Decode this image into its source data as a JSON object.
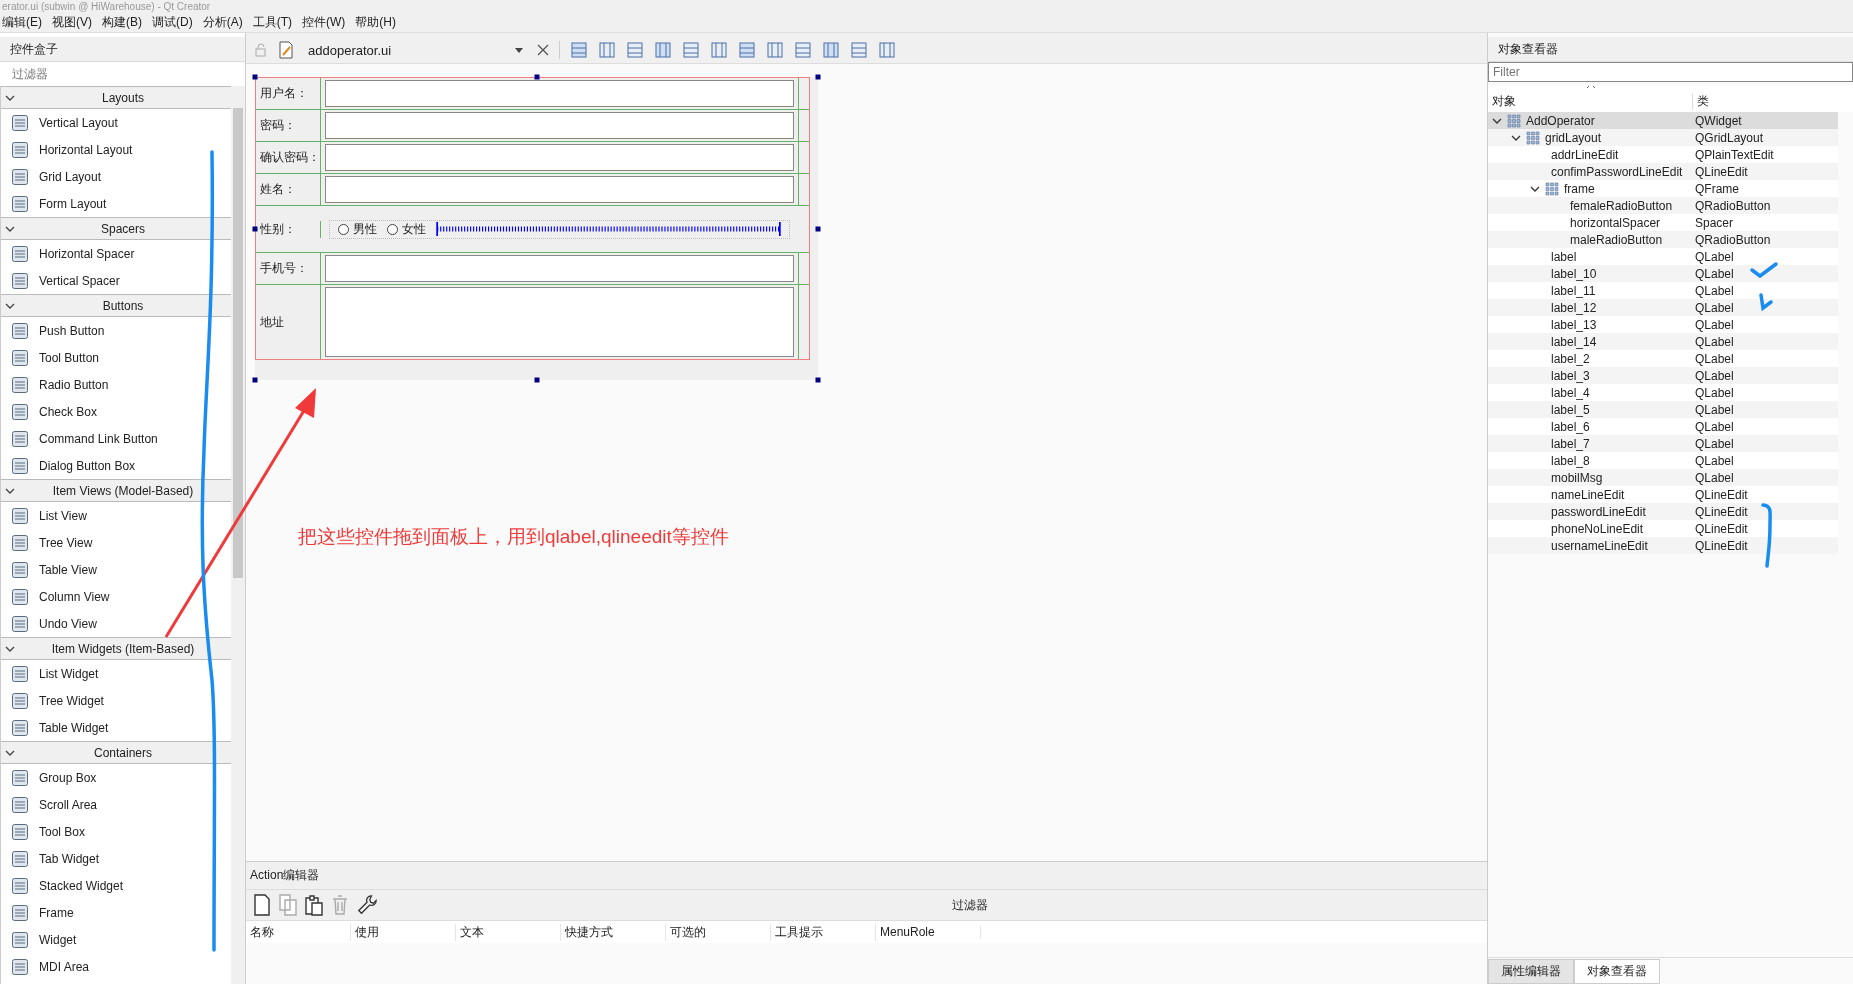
{
  "window": {
    "title": "erator.ui (subwin @ HiWarehouse) - Qt Creator"
  },
  "menu": [
    "编辑(E)",
    "视图(V)",
    "构建(B)",
    "调试(D)",
    "分析(A)",
    "工具(T)",
    "控件(W)",
    "帮助(H)"
  ],
  "widget_box": {
    "title": "控件盒子",
    "filter_placeholder": "过滤器",
    "groups": [
      {
        "title": "Layouts",
        "expanded": true,
        "items": [
          "Vertical Layout",
          "Horizontal Layout",
          "Grid Layout",
          "Form Layout"
        ]
      },
      {
        "title": "Spacers",
        "expanded": true,
        "items": [
          "Horizontal Spacer",
          "Vertical Spacer"
        ]
      },
      {
        "title": "Buttons",
        "expanded": true,
        "items": [
          "Push Button",
          "Tool Button",
          "Radio Button",
          "Check Box",
          "Command Link Button",
          "Dialog Button Box"
        ]
      },
      {
        "title": "Item Views (Model-Based)",
        "expanded": true,
        "items": [
          "List View",
          "Tree View",
          "Table View",
          "Column View",
          "Undo View"
        ]
      },
      {
        "title": "Item Widgets (Item-Based)",
        "expanded": true,
        "items": [
          "List Widget",
          "Tree Widget",
          "Table Widget"
        ]
      },
      {
        "title": "Containers",
        "expanded": true,
        "items": [
          "Group Box",
          "Scroll Area",
          "Tool Box",
          "Tab Widget",
          "Stacked Widget",
          "Frame",
          "Widget",
          "MDI Area"
        ]
      }
    ]
  },
  "editor": {
    "file": "addoperator.ui",
    "form_rows": [
      {
        "label": "用户名：",
        "kind": "line"
      },
      {
        "label": "密码：",
        "kind": "line"
      },
      {
        "label": "确认密码：",
        "kind": "line"
      },
      {
        "label": "姓名：",
        "kind": "line"
      },
      {
        "label": "性别：",
        "kind": "radio",
        "options": [
          {
            "label": "男性",
            "selected": false
          },
          {
            "label": "女性",
            "selected": false
          }
        ]
      },
      {
        "label": "手机号：",
        "kind": "line"
      },
      {
        "label": "地址",
        "kind": "text"
      }
    ],
    "annotation": "把这些控件拖到面板上，用到qlabel,qlineedit等控件"
  },
  "action_editor": {
    "title": "Action编辑器",
    "filter_label": "过滤器",
    "columns": [
      "名称",
      "使用",
      "文本",
      "快捷方式",
      "可选的",
      "工具提示",
      "MenuRole"
    ]
  },
  "object_inspector": {
    "title": "对象查看器",
    "filter_placeholder": "Filter",
    "columns": [
      "对象",
      "类"
    ],
    "tree": [
      {
        "name": "AddOperator",
        "class": "QWidget",
        "selected": true,
        "expanded": true,
        "children": [
          {
            "name": "gridLayout",
            "class": "QGridLayout",
            "selected": false,
            "expanded": true,
            "children": [
              {
                "name": "addrLineEdit",
                "class": "QPlainTextEdit",
                "selected": false
              },
              {
                "name": "confimPasswordLineEdit",
                "class": "QLineEdit",
                "selected": false
              },
              {
                "name": "frame",
                "class": "QFrame",
                "selected": false,
                "expanded": true,
                "children": [
                  {
                    "name": "femaleRadioButton",
                    "class": "QRadioButton",
                    "selected": false
                  },
                  {
                    "name": "horizontalSpacer",
                    "class": "Spacer",
                    "selected": false
                  },
                  {
                    "name": "maleRadioButton",
                    "class": "QRadioButton",
                    "selected": false
                  }
                ]
              },
              {
                "name": "label",
                "class": "QLabel",
                "selected": false
              },
              {
                "name": "label_10",
                "class": "QLabel",
                "selected": false
              },
              {
                "name": "label_11",
                "class": "QLabel",
                "selected": false
              },
              {
                "name": "label_12",
                "class": "QLabel",
                "selected": false
              },
              {
                "name": "label_13",
                "class": "QLabel",
                "selected": false
              },
              {
                "name": "label_14",
                "class": "QLabel",
                "selected": false
              },
              {
                "name": "label_2",
                "class": "QLabel",
                "selected": false
              },
              {
                "name": "label_3",
                "class": "QLabel",
                "selected": false
              },
              {
                "name": "label_4",
                "class": "QLabel",
                "selected": false
              },
              {
                "name": "label_5",
                "class": "QLabel",
                "selected": false
              },
              {
                "name": "label_6",
                "class": "QLabel",
                "selected": false
              },
              {
                "name": "label_7",
                "class": "QLabel",
                "selected": false
              },
              {
                "name": "label_8",
                "class": "QLabel",
                "selected": false
              },
              {
                "name": "mobilMsg",
                "class": "QLabel",
                "selected": false
              },
              {
                "name": "nameLineEdit",
                "class": "QLineEdit",
                "selected": false
              },
              {
                "name": "passwordLineEdit",
                "class": "QLineEdit",
                "selected": false
              },
              {
                "name": "phoneNoLineEdit",
                "class": "QLineEdit",
                "selected": false
              },
              {
                "name": "usernameLineEdit",
                "class": "QLineEdit",
                "selected": false
              }
            ]
          }
        ]
      }
    ]
  },
  "bottom_tabs": [
    {
      "label": "属性编辑器",
      "selected": false
    },
    {
      "label": "对象查看器",
      "selected": true
    }
  ]
}
